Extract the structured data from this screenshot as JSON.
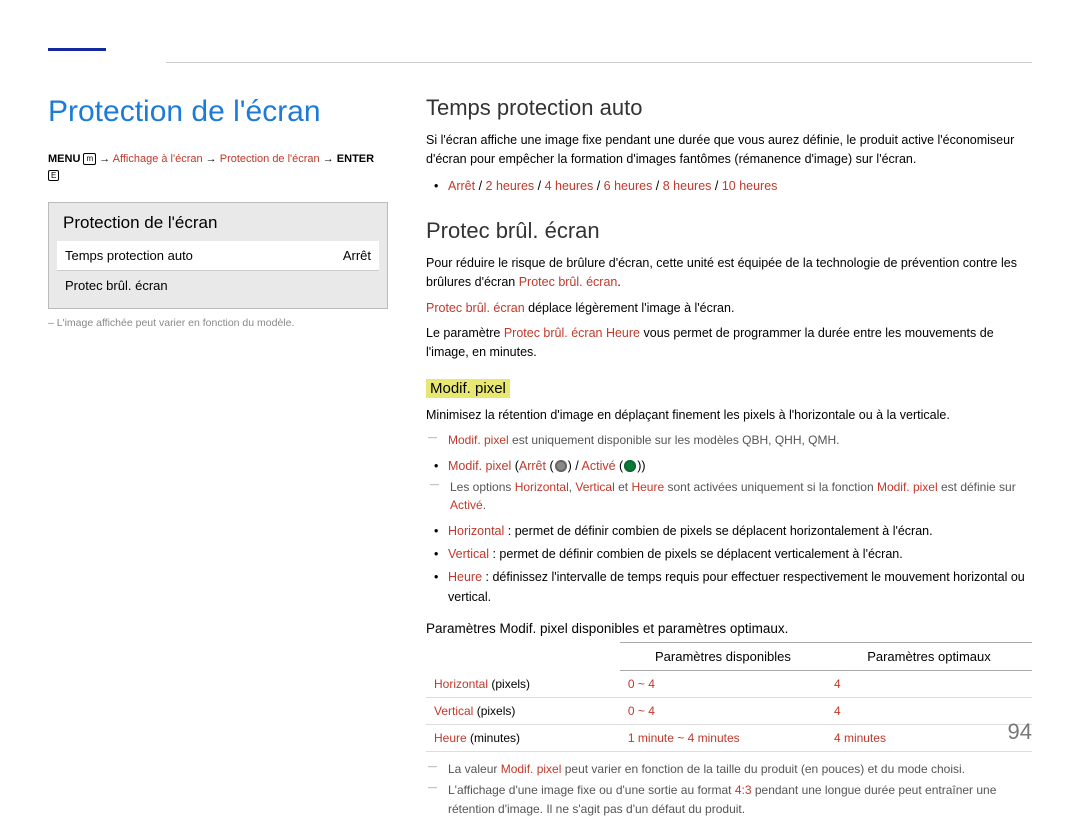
{
  "page_title": "Protection de l'écran",
  "menu_path": {
    "prefix": "MENU",
    "icon": "m",
    "arrow": "→",
    "seg1": "Affichage à l'écran",
    "seg2": "Protection de l'écran",
    "suffix": "ENTER",
    "enter_icon": "E"
  },
  "preview": {
    "title": "Protection de l'écran",
    "row1_label": "Temps protection auto",
    "row1_value": "Arrêt",
    "row2_label": "Protec brûl. écran"
  },
  "img_note": "– L'image affichée peut varier en fonction du modèle.",
  "sect1": {
    "h": "Temps protection auto",
    "p": "Si l'écran affiche une image fixe pendant une durée que vous aurez définie, le produit active l'économiseur d'écran pour empêcher la formation d'images fantômes (rémanence d'image) sur l'écran.",
    "bullet_off": "Arrêt",
    "bullet_sep": " / ",
    "opts": [
      "2 heures",
      "4 heures",
      "6 heures",
      "8 heures",
      "10 heures"
    ]
  },
  "sect2": {
    "h": "Protec brûl. écran",
    "p_a": "Pour réduire le risque de brûlure d'écran, cette unité est équipée de la technologie de prévention contre les brûlures d'écran ",
    "p_a_red": "Protec brûl. écran",
    "p_b_red": "Protec brûl. écran",
    "p_b_tail": " déplace légèrement l'image à l'écran.",
    "p_c_pre": "Le paramètre ",
    "p_c_red": "Protec brûl. écran Heure",
    "p_c_tail": " vous permet de programmer la durée entre les mouvements de l'image, en minutes."
  },
  "modif": {
    "h": "Modif. pixel",
    "p": "Minimisez la rétention d'image en déplaçant finement les pixels à l'horizontale ou à la verticale.",
    "dash1_red": "Modif. pixel",
    "dash1_tail": " est uniquement disponible sur les modèles QBH, QHH, QMH.",
    "b1_red1": "Modif. pixel",
    "b1_off": "Arrêt",
    "b1_on": "Activé",
    "dash2_pre": "Les options ",
    "dash2_h": "Horizontal",
    "dash2_v": "Vertical",
    "dash2_et": " et ",
    "dash2_heure": "Heure",
    "dash2_mid": " sont activées uniquement si la fonction ",
    "dash2_mp": "Modif. pixel",
    "dash2_tail": " est définie sur ",
    "dash2_act": "Activé",
    "b2_lbl": "Horizontal",
    "b2_txt": " : permet de définir combien de pixels se déplacent horizontalement à l'écran.",
    "b3_lbl": "Vertical",
    "b3_txt": " : permet de définir combien de pixels se déplacent verticalement à l'écran.",
    "b4_lbl": "Heure",
    "b4_txt": " : définissez l'intervalle de temps requis pour effectuer respectivement le mouvement horizontal ou vertical."
  },
  "table": {
    "caption": "Paramètres Modif. pixel disponibles et paramètres optimaux.",
    "th_avail": "Paramètres disponibles",
    "th_opt": "Paramètres optimaux",
    "rows": [
      {
        "label": "Horizontal",
        "unit": " (pixels)",
        "avail": "0 ~ 4",
        "opt": "4"
      },
      {
        "label": "Vertical",
        "unit": " (pixels)",
        "avail": "0 ~ 4",
        "opt": "4"
      },
      {
        "label": "Heure",
        "unit": " (minutes)",
        "avail": "1 minute ~ 4 minutes",
        "opt": "4 minutes"
      }
    ],
    "foot1_pre": "La valeur ",
    "foot1_red": "Modif. pixel",
    "foot1_tail": " peut varier en fonction de la taille du produit (en pouces) et du mode choisi.",
    "foot2_pre": "L'affichage d'une image fixe ou d'une sortie au format ",
    "foot2_red": "4:3",
    "foot2_tail": " pendant une longue durée peut entraîner une rétention d'image. Il ne s'agit pas d'un défaut du produit."
  },
  "page_number": "94"
}
